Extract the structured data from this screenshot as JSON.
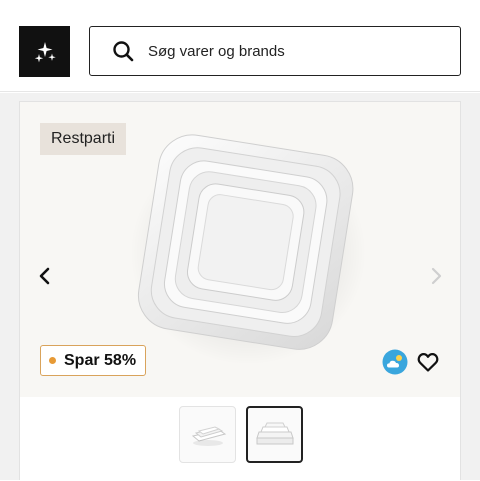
{
  "header": {
    "logo_icon": "sparkles-icon",
    "search": {
      "placeholder": "Søg varer og brands",
      "icon": "search-icon"
    }
  },
  "product": {
    "badge": "Restparti",
    "image_icon": "ceramic-baking-dishes-image",
    "discount": "Spar 58%",
    "discount_dot_color": "#e79a35",
    "discount_border_color": "#d9a35b",
    "nav": {
      "prev_icon": "chevron-left-icon",
      "next_icon": "chevron-right-icon"
    },
    "eco_icon": "cloud-sun-icon",
    "favorite_icon": "heart-icon",
    "thumbnails": [
      {
        "icon": "thumbnail-image",
        "selected": false
      },
      {
        "icon": "thumbnail-image",
        "selected": true
      }
    ]
  }
}
